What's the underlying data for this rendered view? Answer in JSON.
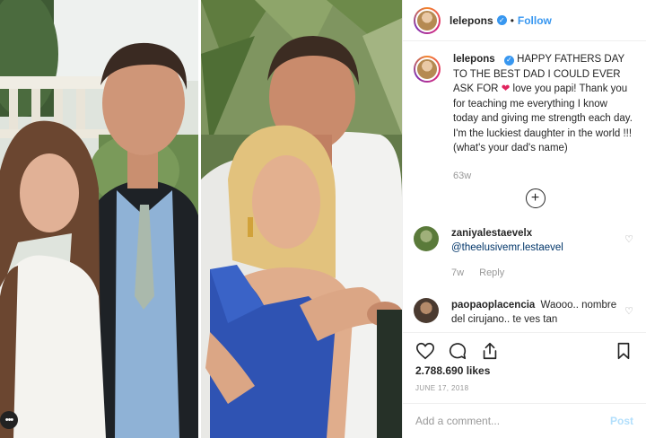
{
  "post": {
    "username": "lelepons",
    "follow_label": "Follow",
    "separator": "•",
    "verified_glyph": "✓",
    "caption": {
      "before_heart": "HAPPY FATHERS DAY TO THE BEST DAD I COULD EVER ASK FOR",
      "heart": "❤",
      "after_heart": " love you papi! Thank you for teaching me everything I know today and giving me strength each day. I'm the luckiest daughter in the world !!! (what's your dad's name)"
    },
    "caption_time": "63w",
    "load_more_glyph": "+",
    "likes": "2.788.690 likes",
    "date": "JUNE 17, 2018",
    "comment_placeholder": "Add a comment...",
    "post_label": "Post"
  },
  "comments": [
    {
      "username": "zaniyalestaevelx",
      "text": "@theelusivemr.lestaevel",
      "time": "7w",
      "reply": "Reply",
      "heart_glyph": "♡",
      "avatar_color": "#5a7a3a"
    },
    {
      "username": "paopaoplacencia",
      "text": "Waooo.. nombre del cirujano.. te ves tan",
      "heart_glyph": "♡",
      "avatar_color": "#4a3a30"
    }
  ],
  "icons": {
    "like": "heart-outline-icon",
    "comment": "comment-icon",
    "share": "share-icon",
    "save": "bookmark-icon",
    "more": "more-options-icon"
  },
  "more_glyph": "•••",
  "colors": {
    "link_blue": "#3897f0",
    "mention": "#003569",
    "muted": "#999999",
    "text": "#262626"
  }
}
